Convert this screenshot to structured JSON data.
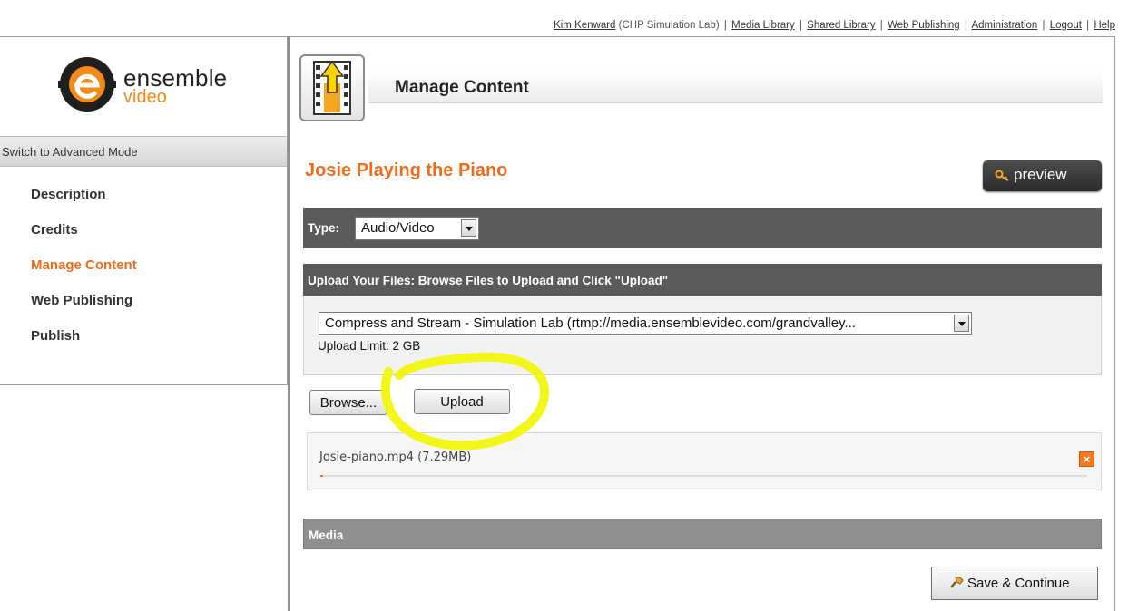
{
  "top_nav": {
    "user_name": "Kim Kenward",
    "org": "(CHP Simulation Lab)",
    "sep": "|",
    "links": [
      "Media Library",
      "Shared Library",
      "Web Publishing",
      "Administration",
      "Logout",
      "Help"
    ]
  },
  "logo": {
    "line1": "ensemble",
    "line2": "video"
  },
  "sidebar": {
    "mode_toggle": "Switch to Advanced Mode",
    "items": [
      {
        "label": "Description",
        "active": false
      },
      {
        "label": "Credits",
        "active": false
      },
      {
        "label": "Manage Content",
        "active": true
      },
      {
        "label": "Web Publishing",
        "active": false
      },
      {
        "label": "Publish",
        "active": false
      }
    ]
  },
  "header": {
    "title": "Manage Content",
    "icon": "upload-film-icon"
  },
  "content": {
    "title": "Josie Playing the Piano",
    "preview_label": "preview",
    "type_label": "Type:",
    "type_value": "Audio/Video",
    "upload_heading": "Upload Your Files: Browse Files to Upload and Click \"Upload\"",
    "stream_option": "Compress and Stream - Simulation Lab (rtmp://media.ensemblevideo.com/grandvalley...",
    "upload_limit": "Upload Limit: 2 GB",
    "browse_label": "Browse...",
    "upload_label": "Upload",
    "file": {
      "name": "Josie-piano.mp4 (7.29MB)",
      "progress_percent": 0.3,
      "remove_icon": "close-icon"
    },
    "media_heading": "Media",
    "save_label": "Save & Continue"
  },
  "colors": {
    "accent": "#f26b1d",
    "brand_orange": "#f28c18",
    "bar_dark": "#5a5a5a",
    "highlight": "#f3f500"
  }
}
